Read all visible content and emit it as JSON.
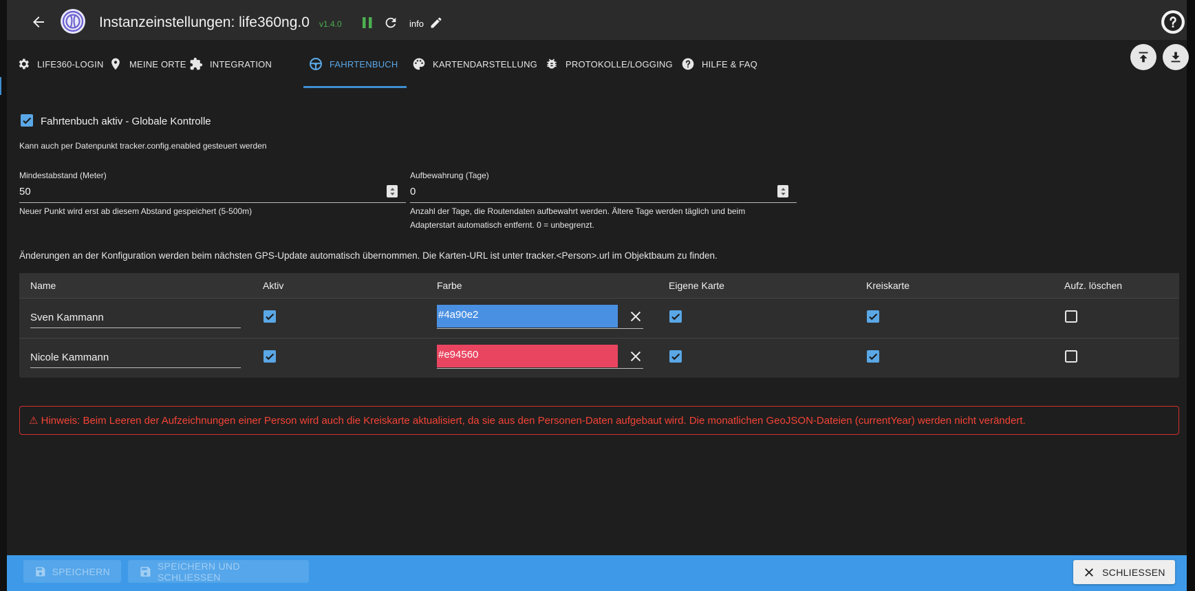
{
  "header": {
    "title": "Instanzeinstellungen: life360ng.0",
    "version": "v1.4.0",
    "info_label": "info"
  },
  "tabs": [
    {
      "label": "LIFE360-LOGIN",
      "icon": "gear-icon"
    },
    {
      "label": "MEINE ORTE",
      "icon": "location-pin-icon"
    },
    {
      "label": "INTEGRATION",
      "icon": "puzzle-icon"
    },
    {
      "label": "FAHRTENBUCH",
      "icon": "steering-wheel-icon",
      "active": true
    },
    {
      "label": "KARTENDARSTELLUNG",
      "icon": "palette-icon"
    },
    {
      "label": "PROTOKOLLE/LOGGING",
      "icon": "bug-icon"
    },
    {
      "label": "HILFE & FAQ",
      "icon": "help-circle-icon"
    }
  ],
  "content": {
    "main_check_label": "Fahrtenbuch aktiv - Globale Kontrolle",
    "main_check_checked": true,
    "main_check_desc": "Kann auch per Datenpunkt tracker.config.enabled gesteuert werden",
    "distance": {
      "label": "Mindestabstand (Meter)",
      "value": "50",
      "help": "Neuer Punkt wird erst ab diesem Abstand gespeichert (5-500m)"
    },
    "retention": {
      "label": "Aufbewahrung (Tage)",
      "value": "0",
      "help_line1": "Anzahl der Tage, die Routendaten aufbewahrt werden. Ältere Tage werden täglich und beim",
      "help_line2": "Adapterstart automatisch entfernt. 0 = unbegrenzt."
    },
    "notice": "Änderungen an der Konfiguration werden beim nächsten GPS-Update automatisch übernommen. Die Karten-URL ist unter tracker.<Person>.url im Objektbaum zu finden."
  },
  "table": {
    "headers": [
      "Name",
      "Aktiv",
      "Farbe",
      "Eigene Karte",
      "Kreiskarte",
      "Aufz. löschen"
    ],
    "rows": [
      {
        "name": "Sven Kammann",
        "aktiv": true,
        "farbe": "#4a90e2",
        "eigene_karte": true,
        "kreiskarte": true,
        "loeschen": false
      },
      {
        "name": "Nicole Kammann",
        "aktiv": true,
        "farbe": "#e94560",
        "eigene_karte": true,
        "kreiskarte": true,
        "loeschen": false
      }
    ]
  },
  "alert": "⚠ Hinweis: Beim Leeren der Aufzeichnungen einer Person wird auch die Kreiskarte aktualisiert, da sie aus den Personen-Daten aufgebaut wird. Die monatlichen GeoJSON-Dateien (currentYear) werden nicht verändert.",
  "footer": {
    "save": "SPEICHERN",
    "save_close": "SPEICHERN UND SCHLIESSEN",
    "close": "SCHLIESSEN"
  },
  "colors": {
    "accent": "#3e8ed0",
    "footer": "#3e9ae8",
    "alert": "#f44336"
  }
}
